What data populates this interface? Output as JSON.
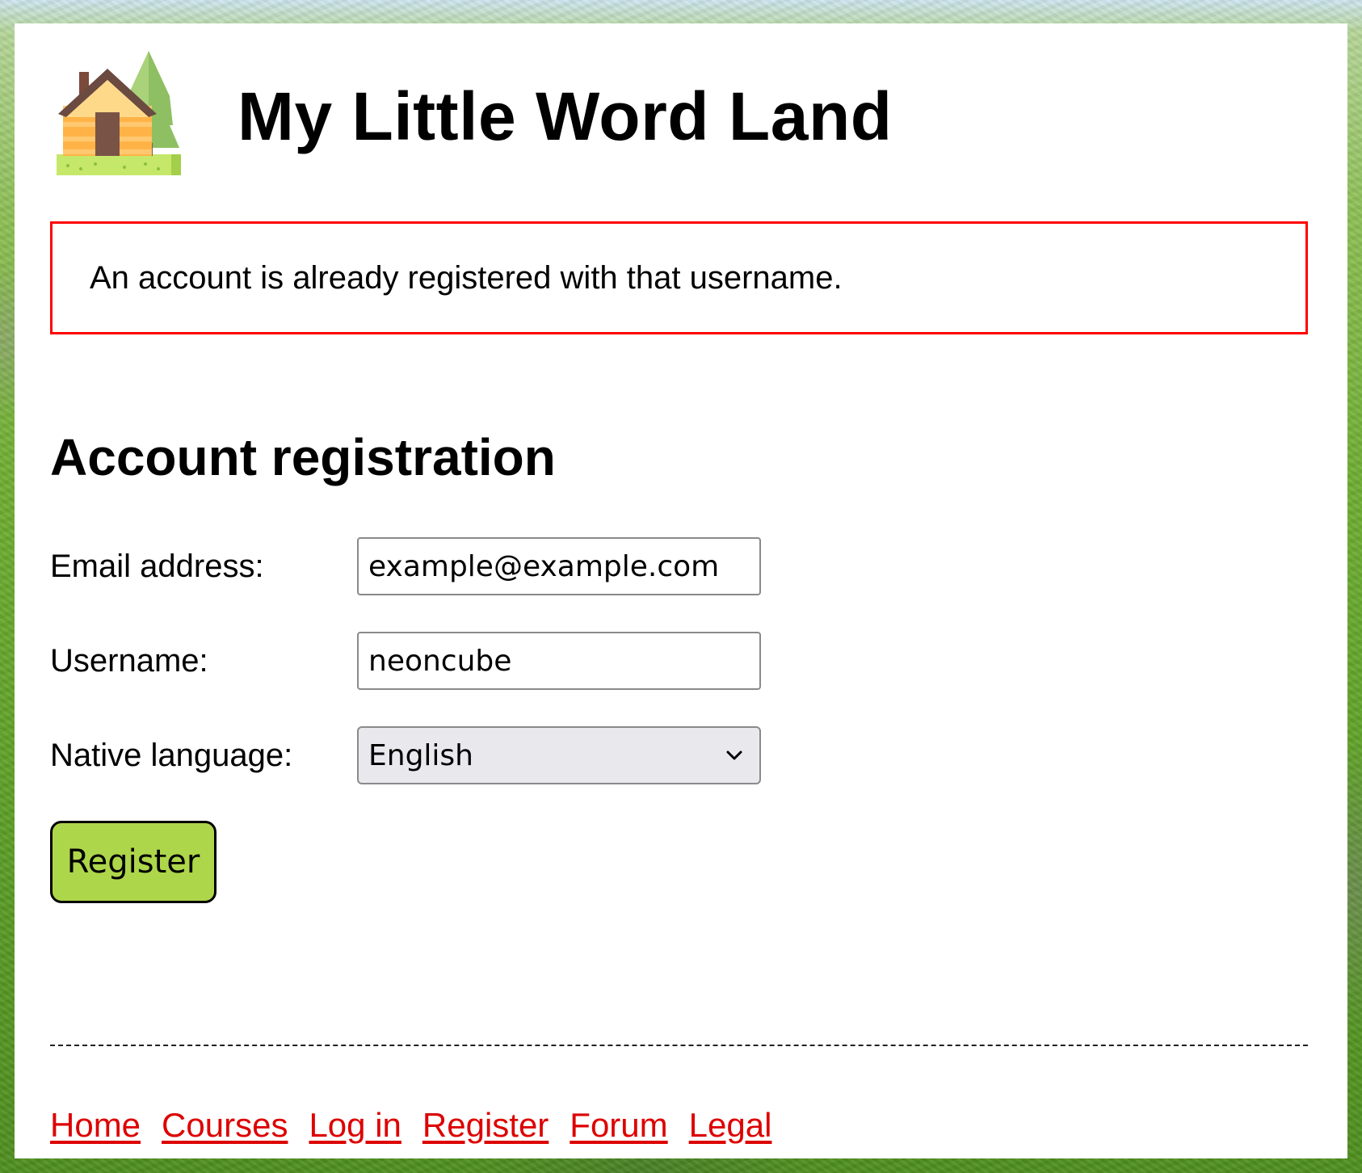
{
  "site": {
    "title": "My Little Word Land",
    "logo_icon": "house-with-tree-icon"
  },
  "alert": {
    "message": "An account is already registered with that username.",
    "border_color": "#ff0000"
  },
  "registration": {
    "heading": "Account registration",
    "email": {
      "label": "Email address:",
      "value": "example@example.com"
    },
    "username": {
      "label": "Username:",
      "value": "neoncube"
    },
    "native_language": {
      "label": "Native language:",
      "selected": "English"
    },
    "submit_label": "Register",
    "submit_color": "#aed64a"
  },
  "footer": {
    "links": [
      {
        "label": "Home"
      },
      {
        "label": "Courses"
      },
      {
        "label": "Log in"
      },
      {
        "label": "Register"
      },
      {
        "label": "Forum"
      },
      {
        "label": "Legal"
      }
    ],
    "link_color": "#dd0000"
  }
}
